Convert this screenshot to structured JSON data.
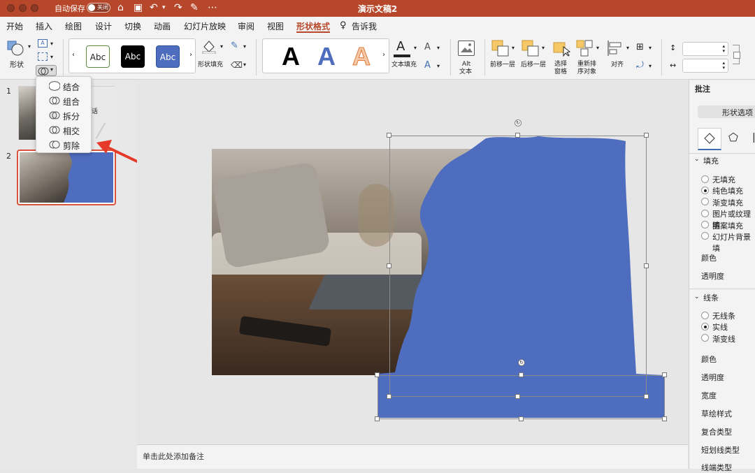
{
  "titlebar": {
    "autosave_label": "自动保存",
    "autosave_state": "关闭",
    "document_title": "演示文稿2"
  },
  "menu": {
    "tabs": [
      {
        "label": "开始"
      },
      {
        "label": "插入"
      },
      {
        "label": "绘图"
      },
      {
        "label": "设计"
      },
      {
        "label": "切换"
      },
      {
        "label": "动画"
      },
      {
        "label": "幻灯片放映"
      },
      {
        "label": "审阅"
      },
      {
        "label": "视图"
      },
      {
        "label": "形状格式",
        "active": true
      },
      {
        "label": "告诉我"
      }
    ]
  },
  "ribbon": {
    "shapes_label": "形状",
    "style_previews": [
      "Abc",
      "Abc",
      "Abc"
    ],
    "shape_fill_label": "形状填充",
    "wordart_letters": [
      "A",
      "A",
      "A"
    ],
    "text_fill_label": "文本填充",
    "alt_text_label_1": "Alt",
    "alt_text_label_2": "文本",
    "bring_forward_label": "前移一层",
    "send_backward_label": "后移一层",
    "selection_pane_label_1": "选择",
    "selection_pane_label_2": "窗格",
    "reorder_label_1": "重新排",
    "reorder_label_2": "序对象",
    "align_label": "对齐"
  },
  "merge_menu": {
    "items": [
      {
        "label": "结合",
        "icon": "union-icon"
      },
      {
        "label": "组合",
        "icon": "combine-icon"
      },
      {
        "label": "拆分",
        "icon": "fragment-icon"
      },
      {
        "label": "相交",
        "icon": "intersect-icon"
      },
      {
        "label": "剪除",
        "icon": "subtract-icon"
      }
    ]
  },
  "slides": {
    "numbers": [
      "1",
      "2"
    ],
    "slide1_text": "话"
  },
  "notes": {
    "placeholder": "单击此处添加备注"
  },
  "format_pane": {
    "title": "批注",
    "shape_options_tab": "形状选项",
    "fill_section": "填充",
    "fill_options": [
      {
        "label": "无填充",
        "selected": false
      },
      {
        "label": "纯色填充",
        "selected": true
      },
      {
        "label": "渐变填充",
        "selected": false
      },
      {
        "label": "图片或纹理填",
        "selected": false
      },
      {
        "label": "图案填充",
        "selected": false
      },
      {
        "label": "幻灯片背景填",
        "selected": false
      }
    ],
    "color_label": "颜色",
    "transparency_label": "透明度",
    "line_section": "线条",
    "line_options": [
      {
        "label": "无线条",
        "selected": false
      },
      {
        "label": "实线",
        "selected": true
      },
      {
        "label": "渐变线",
        "selected": false
      }
    ],
    "line_color_label": "颜色",
    "line_transparency_label": "透明度",
    "width_label": "宽度",
    "sketch_label": "草绘样式",
    "compound_label": "复合类型",
    "dash_label": "短划线类型",
    "cap_label": "线端类型"
  },
  "colors": {
    "accent": "#b7472a",
    "shape_blue": "#4f6dbf",
    "arrow_red": "#e53a2a"
  }
}
